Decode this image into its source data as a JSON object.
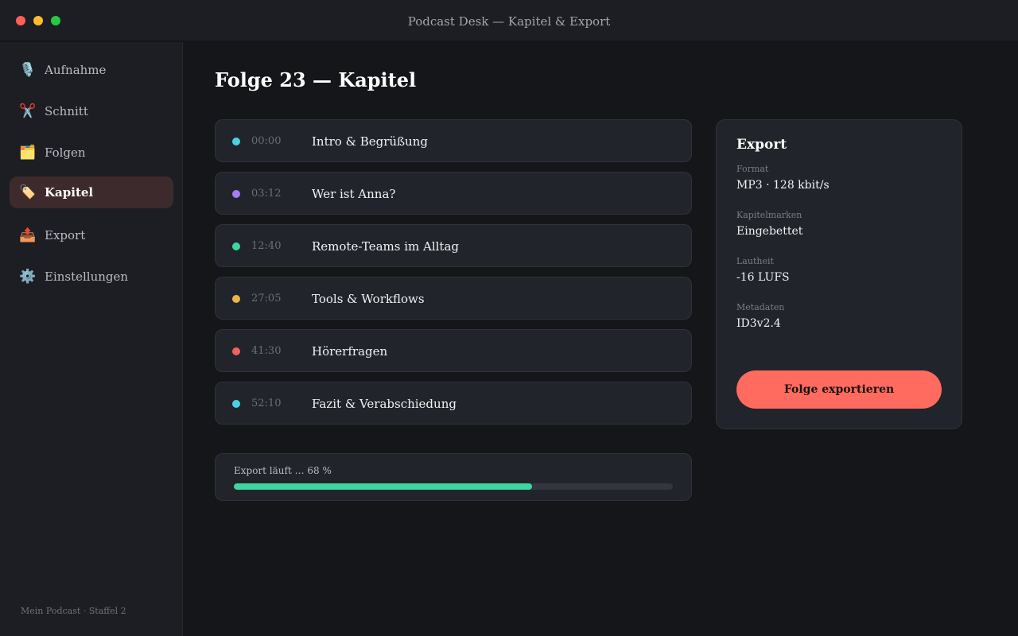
{
  "window": {
    "title": "Podcast Desk — Kapitel & Export"
  },
  "sidebar": {
    "items": [
      {
        "label": "Aufnahme",
        "icon": "microphone-icon",
        "glyph": "🎙️",
        "active": false
      },
      {
        "label": "Schnitt",
        "icon": "scissors-icon",
        "glyph": "✂️",
        "active": false
      },
      {
        "label": "Folgen",
        "icon": "folder-icon",
        "glyph": "🗂️",
        "active": false
      },
      {
        "label": "Kapitel",
        "icon": "tag-icon",
        "glyph": "🏷️",
        "active": true
      },
      {
        "label": "Export",
        "icon": "outbox-icon",
        "glyph": "📤",
        "active": false
      },
      {
        "label": "Einstellungen",
        "icon": "gear-icon",
        "glyph": "⚙️",
        "active": false
      }
    ],
    "footer": "Mein Podcast · Staffel 2"
  },
  "main": {
    "title": "Folge 23 — Kapitel",
    "chapters": [
      {
        "time": "00:00",
        "title": "Intro & Begrüßung",
        "color": "#4dd0e1"
      },
      {
        "time": "03:12",
        "title": "Wer ist Anna?",
        "color": "#a47cf3"
      },
      {
        "time": "12:40",
        "title": "Remote-Teams im Alltag",
        "color": "#3ed6a0"
      },
      {
        "time": "27:05",
        "title": "Tools & Workflows",
        "color": "#e9b44c"
      },
      {
        "time": "41:30",
        "title": "Hörerfragen",
        "color": "#f0625a"
      },
      {
        "time": "52:10",
        "title": "Fazit & Verabschiedung",
        "color": "#4dd0e1"
      }
    ],
    "progress": {
      "label": "Export läuft … 68 %",
      "percent": 68,
      "color": "#3ed6a0"
    }
  },
  "export": {
    "title": "Export",
    "fields": [
      {
        "label": "Format",
        "value": "MP3 · 128 kbit/s"
      },
      {
        "label": "Kapitelmarken",
        "value": "Eingebettet"
      },
      {
        "label": "Lautheit",
        "value": "-16 LUFS"
      },
      {
        "label": "Metadaten",
        "value": "ID3v2.4"
      }
    ],
    "button_label": "Folge exportieren",
    "button_color": "#ff6b5e"
  }
}
